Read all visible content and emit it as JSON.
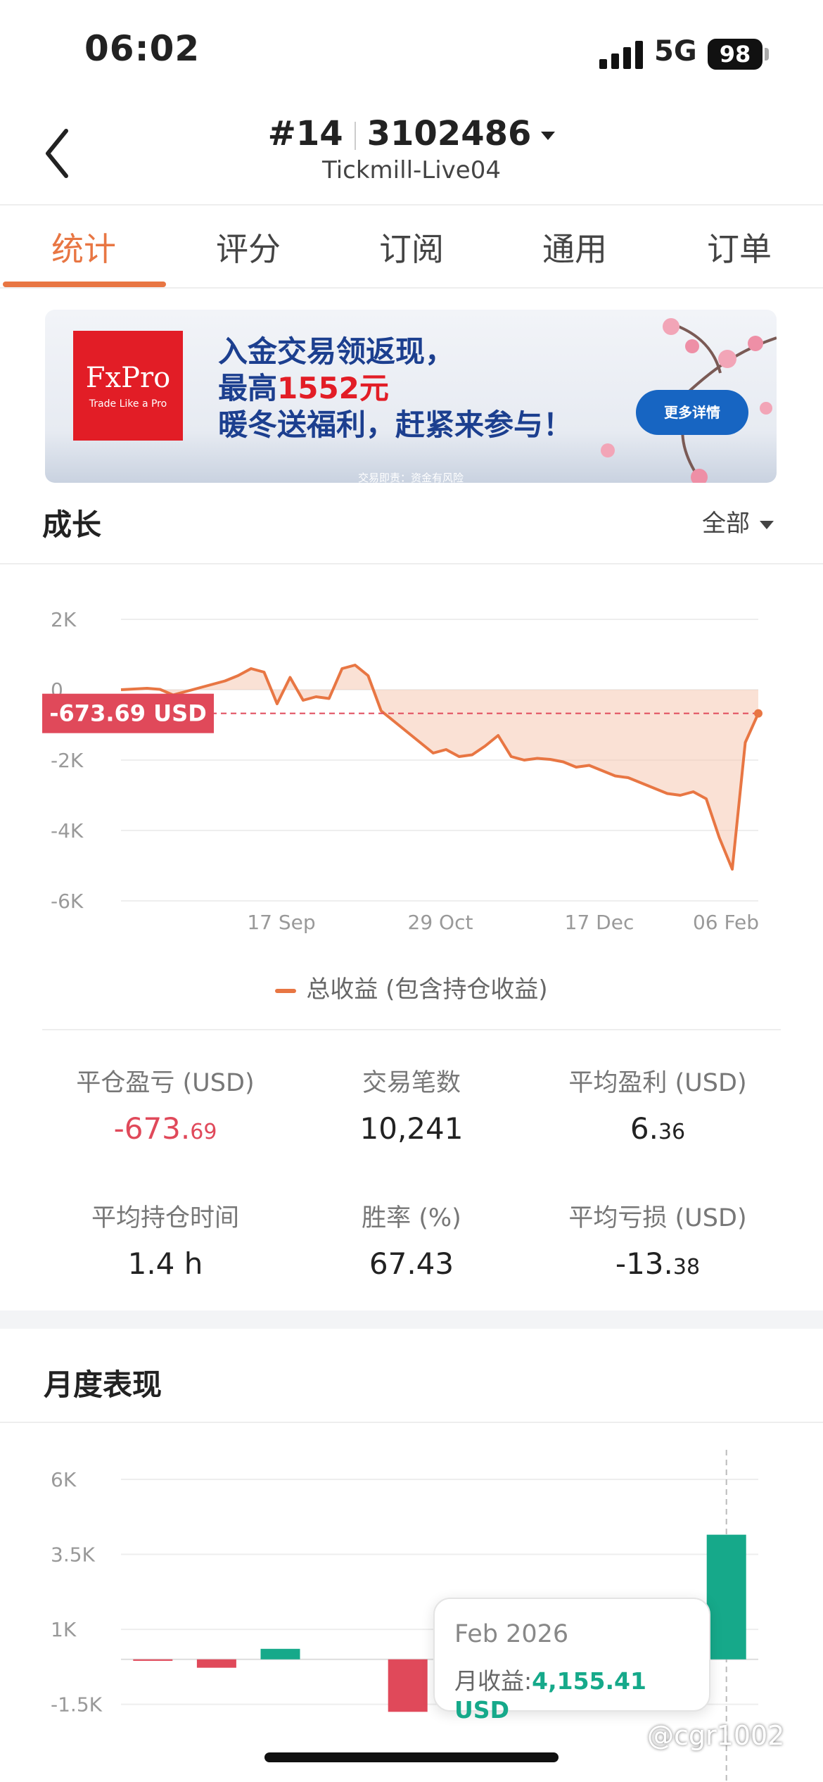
{
  "status_bar": {
    "time": "06:02",
    "network": "5G",
    "battery": "98"
  },
  "header": {
    "rank": "#14",
    "account": "3102486",
    "server": "Tickmill-Live04"
  },
  "tabs": [
    "统计",
    "评分",
    "订阅",
    "通用",
    "订单"
  ],
  "active_tab": 0,
  "banner": {
    "logo": "FxPro",
    "logo_tagline": "Trade Like a Pro",
    "line1": "入金交易领返现，",
    "line2_prefix": "最高",
    "line2_highlight": "1552元",
    "line3": "暖冬送福利，赶紧来参与！",
    "button": "更多详情",
    "footer": "交易即责：资金有风险"
  },
  "growth": {
    "title": "成长",
    "filter": "全部",
    "current_label": "-673.69 USD",
    "legend": "总收益 (包含持仓收益)"
  },
  "stats": [
    {
      "label": "平仓盈亏 (USD)",
      "int": "-673.",
      "dec": "69",
      "negative": true
    },
    {
      "label": "交易笔数",
      "int": "10,241",
      "dec": ""
    },
    {
      "label": "平均盈利 (USD)",
      "int": "6.",
      "dec": "36"
    },
    {
      "label": "平均持仓时间",
      "int": "1.4 h",
      "dec": ""
    },
    {
      "label": "胜率 (%)",
      "int": "67.43",
      "dec": ""
    },
    {
      "label": "平均亏损 (USD)",
      "int": "-13.",
      "dec": "38"
    }
  ],
  "monthly": {
    "title": "月度表现",
    "tooltip_month": "Feb 2026",
    "tooltip_label": "月收益:",
    "tooltip_value": "4,155.41 USD"
  },
  "watermark": "@cgr1002",
  "colors": {
    "accent": "#e87643",
    "negative": "#e0495a",
    "positive": "#16a98a"
  },
  "chart_data": [
    {
      "type": "area",
      "y_ticks": [
        "2K",
        "0",
        "-2K",
        "-4K",
        "-6K"
      ],
      "ylim": [
        -6000,
        2000
      ],
      "x_ticks": [
        "17 Sep",
        "29 Oct",
        "17 Dec",
        "06 Feb"
      ],
      "series": [
        {
          "name": "总收益 (包含持仓收益)",
          "values": [
            0,
            20,
            40,
            10,
            -150,
            -50,
            50,
            150,
            250,
            400,
            600,
            500,
            -400,
            350,
            -300,
            -200,
            -250,
            600,
            700,
            400,
            -600,
            -900,
            -1200,
            -1500,
            -1800,
            -1700,
            -1900,
            -1850,
            -1600,
            -1300,
            -1900,
            -2000,
            -1950,
            -1980,
            -2050,
            -2200,
            -2150,
            -2300,
            -2450,
            -2500,
            -2650,
            -2800,
            -2950,
            -3000,
            -2900,
            -3100,
            -4200,
            -5100,
            -1500,
            -673.69
          ]
        }
      ],
      "current_value": -673.69,
      "grid": true
    },
    {
      "type": "bar",
      "y_ticks": [
        "6K",
        "3.5K",
        "1K",
        "-1.5K"
      ],
      "ylim": [
        -2400,
        6000
      ],
      "series": [
        {
          "name": "月收益",
          "values": [
            -50,
            -280,
            350,
            0,
            -1750,
            0,
            0,
            0,
            -1600,
            4155.41
          ]
        }
      ],
      "highlight": "Feb 2026",
      "grid": true
    }
  ]
}
